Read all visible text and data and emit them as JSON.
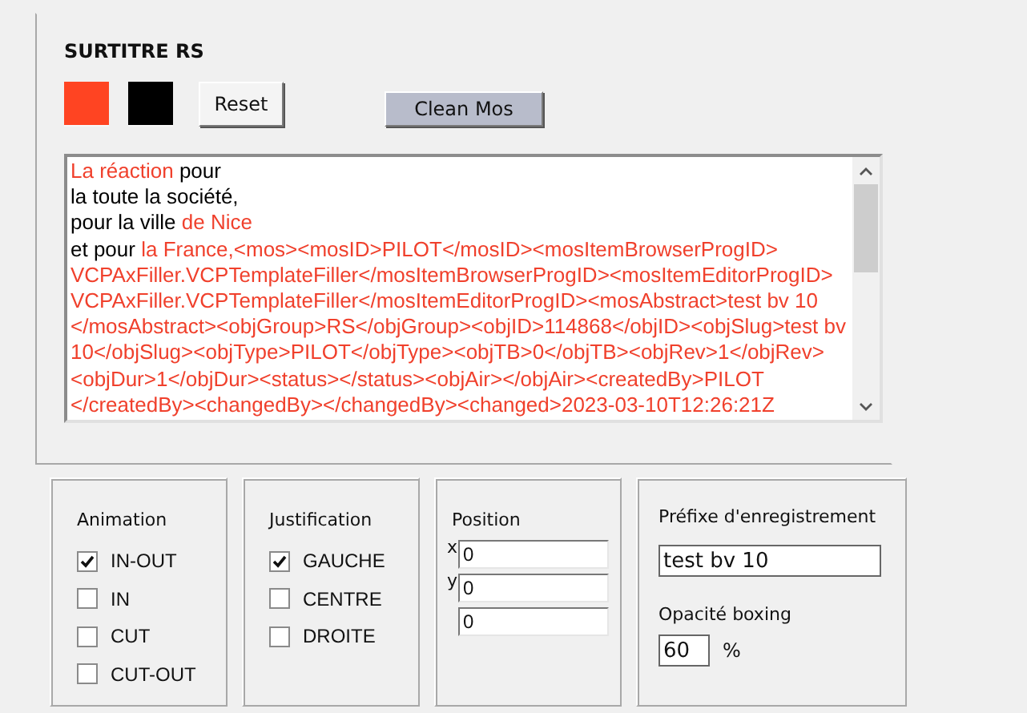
{
  "header": {
    "title": "SURTITRE RS"
  },
  "color_swatches": [
    {
      "color": "#ff4422"
    },
    {
      "color": "#000000"
    }
  ],
  "buttons": [
    {
      "label": "Reset",
      "kind": "plain"
    },
    {
      "label": "Clean Mos",
      "kind": "accent"
    }
  ],
  "editor": {
    "lines": [
      [
        {
          "text": "La réaction",
          "highlighted": true
        },
        {
          "text": " pour",
          "highlighted": false
        }
      ],
      [
        {
          "text": "la toute la société,",
          "highlighted": false
        }
      ],
      [
        {
          "text": "pour la ville ",
          "highlighted": false
        },
        {
          "text": "de Nice",
          "highlighted": true
        }
      ],
      [
        {
          "text": "et pour ",
          "highlighted": false
        },
        {
          "text": "la France,<mos><mosID>PILOT</mosID><mosItemBrowserProgID>",
          "highlighted": true
        }
      ],
      [
        {
          "text": "VCPAxFiller.VCPTemplateFiller</mosItemBrowserProgID><mosItemEditorProgID>",
          "highlighted": true
        }
      ],
      [
        {
          "text": "VCPAxFiller.VCPTemplateFiller</mosItemEditorProgID><mosAbstract>test bv 10",
          "highlighted": true
        }
      ],
      [
        {
          "text": "</mosAbstract><objGroup>RS</objGroup><objID>114868</objID><objSlug>test bv",
          "highlighted": true
        }
      ],
      [
        {
          "text": "10</objSlug><objType>PILOT</objType><objTB>0</objTB><objRev>1</objRev>",
          "highlighted": true
        }
      ],
      [
        {
          "text": "<objDur>1</objDur><status></status><objAir></objAir><createdBy>PILOT",
          "highlighted": true
        }
      ],
      [
        {
          "text": "</createdBy><changedBy></changedBy><changed>2023-03-10T12:26:21Z",
          "highlighted": true
        }
      ]
    ]
  },
  "animation": {
    "title": "Animation",
    "options": [
      {
        "label": "IN-OUT",
        "checked": true
      },
      {
        "label": "IN",
        "checked": false
      },
      {
        "label": "CUT",
        "checked": false
      },
      {
        "label": "CUT-OUT",
        "checked": false
      }
    ]
  },
  "justification": {
    "title": "Justification",
    "options": [
      {
        "label": "GAUCHE",
        "checked": true
      },
      {
        "label": "CENTRE",
        "checked": false
      },
      {
        "label": "DROITE",
        "checked": false
      }
    ]
  },
  "position": {
    "title": "Position",
    "fields": [
      {
        "label": "x",
        "value": "0"
      },
      {
        "label": "y",
        "value": "0"
      },
      {
        "value": "0"
      }
    ]
  },
  "prefix": {
    "title": "Préfixe d'enregistrement",
    "value": "test bv 10"
  },
  "opacity": {
    "title": "Opacité boxing",
    "value": "60",
    "unit": "%"
  }
}
